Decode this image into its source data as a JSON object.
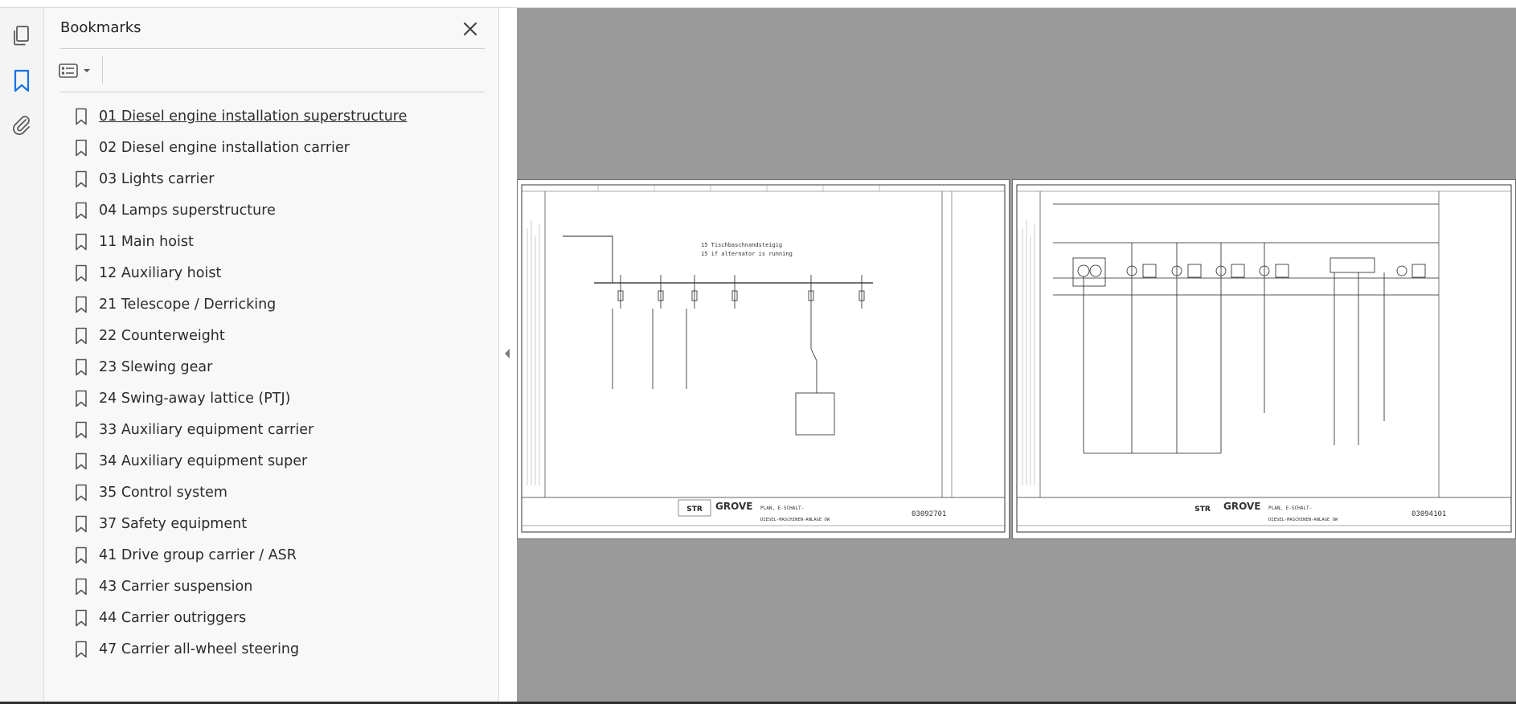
{
  "bookmarks_panel": {
    "title": "Bookmarks",
    "items": [
      {
        "label": "01 Diesel engine installation superstructure"
      },
      {
        "label": "02 Diesel engine installation carrier"
      },
      {
        "label": "03 Lights carrier"
      },
      {
        "label": "04 Lamps superstructure"
      },
      {
        "label": "11 Main hoist"
      },
      {
        "label": "12 Auxiliary hoist"
      },
      {
        "label": "21 Telescope / Derricking"
      },
      {
        "label": "22 Counterweight"
      },
      {
        "label": "23 Slewing gear"
      },
      {
        "label": "24 Swing-away lattice (PTJ)"
      },
      {
        "label": "33 Auxiliary equipment carrier"
      },
      {
        "label": "34 Auxiliary equipment super"
      },
      {
        "label": "35 Control system"
      },
      {
        "label": "37 Safety equipment"
      },
      {
        "label": "41 Drive group carrier / ASR"
      },
      {
        "label": "43 Carrier suspension"
      },
      {
        "label": "44 Carrier outriggers"
      },
      {
        "label": "47 Carrier all-wheel steering"
      }
    ]
  },
  "left_rail": {
    "icons": [
      "pages-icon",
      "bookmark-icon",
      "attachment-icon"
    ]
  },
  "document_pages": [
    {
      "title_block_brand": "GROVE",
      "title_block_code": "STR",
      "drawing_number": "03092701",
      "drawing_title": "PLAN, E-SCHALT-",
      "drawing_subtitle": "DIESEL-MASCHINEN-ANLAGE OW",
      "notes": [
        "15 Tischbaschnandsteigig",
        "15 if alternator is running"
      ]
    },
    {
      "title_block_brand": "GROVE",
      "title_block_code": "STR",
      "drawing_number": "03094101",
      "drawing_title": "PLAN, E-SCHALT-",
      "drawing_subtitle": "DIESEL-MASCHINEN-ANLAGE OW"
    }
  ],
  "colors": {
    "accent": "#1473e6",
    "viewer_bg": "#9a9a9a",
    "panel_bg": "#f8f8f8"
  }
}
